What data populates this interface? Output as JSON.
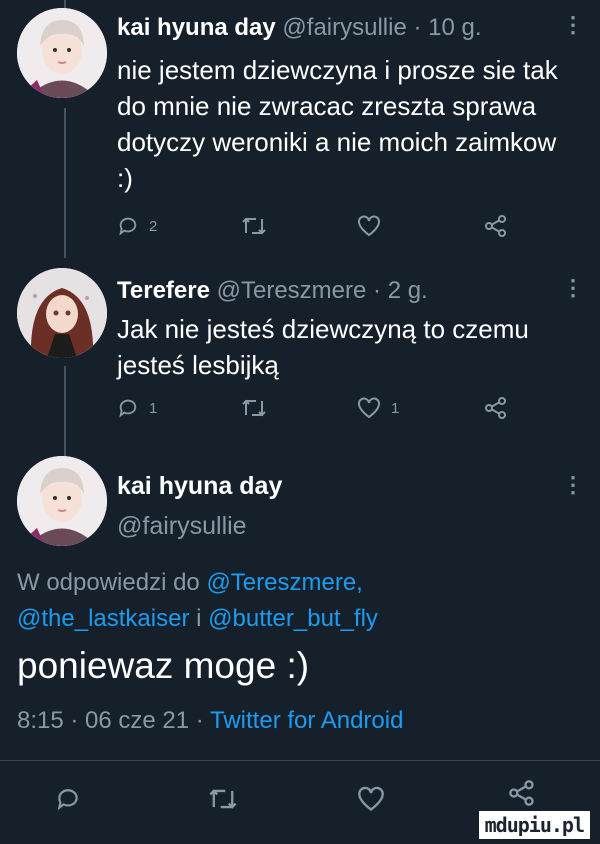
{
  "tweets": [
    {
      "name": "kai hyuna day",
      "handle": "@fairysullie",
      "time": "· 10 g.",
      "text": "nie jestem dziewczyna i prosze sie tak do mnie nie zwracac zreszta sprawa dotyczy weroniki a nie moich zaimkow :)",
      "replies": "2",
      "retweets": "",
      "likes": ""
    },
    {
      "name": "Terefere",
      "handle": "@Tereszmere",
      "time": "· 2 g.",
      "text": "Jak nie jesteś dziewczyną to czemu jesteś lesbijką",
      "replies": "1",
      "retweets": "",
      "likes": "1"
    }
  ],
  "main_tweet": {
    "name": "kai hyuna day",
    "handle": "@fairysullie",
    "reply_prefix": "W odpowiedzi do",
    "mention1": "@Tereszmere,",
    "mention2": "@the_lastkaiser",
    "reply_and": "i",
    "mention3": "@butter_but_fly",
    "text": "poniewaz moge :)",
    "meta": "8:15 · 06 cze 21 ·",
    "client": "Twitter for Android"
  },
  "more_icon": "more-dots-icon",
  "watermark": "mdupiu.pl",
  "colors": {
    "background": "#15202b",
    "text": "#ffffff",
    "muted": "#8899a6",
    "link": "#1d9bf0"
  }
}
